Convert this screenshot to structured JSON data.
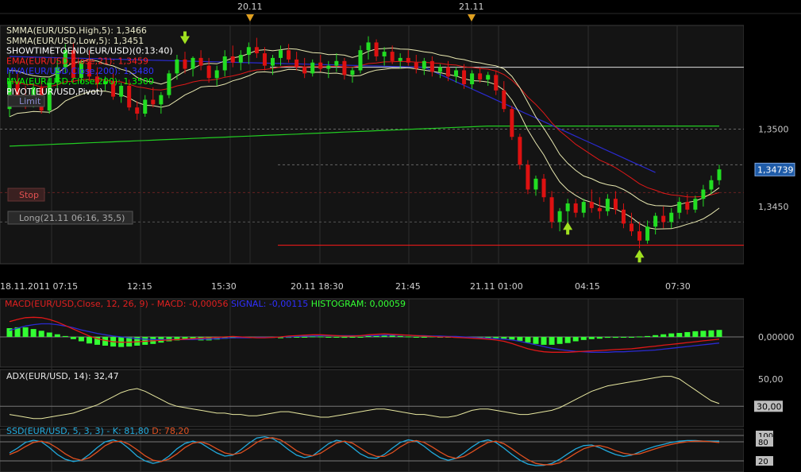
{
  "chart_data": {
    "type": "candlestick",
    "instrument": "EUR/USD",
    "date_markers": [
      "20.11",
      "21.11"
    ],
    "time_axis": [
      "18.11.2011 07:15",
      "12:15",
      "15:30",
      "20.11 18:30",
      "21:45",
      "21.11 01:00",
      "04:15",
      "07:30"
    ],
    "y_ticks": [
      "1,3500",
      "1,3450"
    ],
    "y_tick_values": [
      1.35,
      1.345
    ],
    "y_range": [
      1.3413,
      1.3567
    ],
    "current_price": {
      "label": "1,34739",
      "value": 1.34739
    },
    "legend": [
      {
        "text": "SMMA(EUR/USD,High,5): 1,3466",
        "color": "#e8e8c8"
      },
      {
        "text": "SMMA(EUR/USD,Low,5): 1,3451",
        "color": "#e8e8c8"
      },
      {
        "text": "SHOWTIMETOEND(EUR/USD)(0:13:40)",
        "color": "#ffffff"
      },
      {
        "text": "EMA(EUR/USD,Close,21): 1,3459",
        "color": "#ff2020"
      },
      {
        "text": "MVA(EUR/USD,Close,200): 1,3480",
        "color": "#3030ff"
      },
      {
        "text": "MVA(EUR/USD,Close,200): 1,3500",
        "color": "#00ff00"
      },
      {
        "text": "PIVOT(EUR/USD,Pivot)",
        "color": "#ffffff"
      }
    ],
    "order_tags": {
      "limit": "Limit",
      "stop": "Stop",
      "position": "Long(21.11 06:16, 35,5)"
    },
    "candles": [
      [
        1.3513,
        1.3538,
        1.3508,
        1.3531
      ],
      [
        1.3531,
        1.3536,
        1.3519,
        1.3522
      ],
      [
        1.3522,
        1.3528,
        1.3513,
        1.3516
      ],
      [
        1.3516,
        1.353,
        1.3514,
        1.3527
      ],
      [
        1.3527,
        1.3531,
        1.351,
        1.3512
      ],
      [
        1.3512,
        1.3533,
        1.351,
        1.353
      ],
      [
        1.353,
        1.3546,
        1.3525,
        1.354
      ],
      [
        1.354,
        1.3555,
        1.3536,
        1.3551
      ],
      [
        1.3551,
        1.3556,
        1.353,
        1.3533
      ],
      [
        1.3533,
        1.3545,
        1.353,
        1.3543
      ],
      [
        1.3543,
        1.3551,
        1.3531,
        1.3534
      ],
      [
        1.3534,
        1.354,
        1.3526,
        1.3529
      ],
      [
        1.3529,
        1.3534,
        1.3525,
        1.3531
      ],
      [
        1.3531,
        1.3536,
        1.3519,
        1.3521
      ],
      [
        1.3521,
        1.353,
        1.3517,
        1.3528
      ],
      [
        1.3528,
        1.3532,
        1.3512,
        1.3514
      ],
      [
        1.3514,
        1.3518,
        1.3506,
        1.351
      ],
      [
        1.351,
        1.3522,
        1.3508,
        1.3519
      ],
      [
        1.3519,
        1.3527,
        1.3514,
        1.3516
      ],
      [
        1.3516,
        1.3524,
        1.351,
        1.3522
      ],
      [
        1.3522,
        1.3538,
        1.352,
        1.3536
      ],
      [
        1.3536,
        1.3548,
        1.3532,
        1.3545
      ],
      [
        1.3545,
        1.355,
        1.3536,
        1.3539
      ],
      [
        1.3539,
        1.3547,
        1.3534,
        1.3546
      ],
      [
        1.3546,
        1.3551,
        1.3538,
        1.3541
      ],
      [
        1.3541,
        1.3546,
        1.353,
        1.3533
      ],
      [
        1.3533,
        1.3541,
        1.3528,
        1.3538
      ],
      [
        1.3538,
        1.3551,
        1.3534,
        1.3547
      ],
      [
        1.3547,
        1.3554,
        1.354,
        1.3543
      ],
      [
        1.3543,
        1.3551,
        1.3538,
        1.3548
      ],
      [
        1.3548,
        1.3556,
        1.3542,
        1.3553
      ],
      [
        1.3553,
        1.3559,
        1.3546,
        1.3549
      ],
      [
        1.3549,
        1.3553,
        1.3538,
        1.3541
      ],
      [
        1.3541,
        1.3548,
        1.3535,
        1.3546
      ],
      [
        1.3546,
        1.3554,
        1.3541,
        1.3551
      ],
      [
        1.3551,
        1.3555,
        1.3543,
        1.3545
      ],
      [
        1.3545,
        1.355,
        1.3538,
        1.354
      ],
      [
        1.354,
        1.3546,
        1.3533,
        1.3536
      ],
      [
        1.3536,
        1.3545,
        1.3534,
        1.3543
      ],
      [
        1.3543,
        1.3548,
        1.3537,
        1.3539
      ],
      [
        1.3539,
        1.3544,
        1.3533,
        1.3541
      ],
      [
        1.3541,
        1.3549,
        1.3537,
        1.3544
      ],
      [
        1.3544,
        1.3546,
        1.3532,
        1.3535
      ],
      [
        1.3535,
        1.354,
        1.353,
        1.3538
      ],
      [
        1.3538,
        1.3554,
        1.3536,
        1.3551
      ],
      [
        1.3551,
        1.356,
        1.3545,
        1.3556
      ],
      [
        1.3556,
        1.3558,
        1.3544,
        1.3547
      ],
      [
        1.3547,
        1.3553,
        1.3541,
        1.355
      ],
      [
        1.355,
        1.3554,
        1.3542,
        1.3544
      ],
      [
        1.3544,
        1.3549,
        1.3539,
        1.3546
      ],
      [
        1.3546,
        1.3551,
        1.3541,
        1.3543
      ],
      [
        1.3543,
        1.3548,
        1.3536,
        1.3539
      ],
      [
        1.3539,
        1.3546,
        1.3535,
        1.3544
      ],
      [
        1.3544,
        1.3547,
        1.3534,
        1.3537
      ],
      [
        1.3537,
        1.3542,
        1.3533,
        1.354
      ],
      [
        1.354,
        1.3544,
        1.3531,
        1.3534
      ],
      [
        1.3534,
        1.354,
        1.353,
        1.3538
      ],
      [
        1.3538,
        1.3542,
        1.3526,
        1.3529
      ],
      [
        1.3529,
        1.3538,
        1.3526,
        1.3536
      ],
      [
        1.3536,
        1.354,
        1.353,
        1.3532
      ],
      [
        1.3532,
        1.3537,
        1.3528,
        1.3535
      ],
      [
        1.3535,
        1.3538,
        1.3522,
        1.3525
      ],
      [
        1.3525,
        1.3531,
        1.3511,
        1.3513
      ],
      [
        1.3513,
        1.3515,
        1.3493,
        1.3495
      ],
      [
        1.3495,
        1.3497,
        1.3474,
        1.3477
      ],
      [
        1.3477,
        1.348,
        1.3458,
        1.3461
      ],
      [
        1.3461,
        1.347,
        1.3457,
        1.3468
      ],
      [
        1.3468,
        1.3471,
        1.3453,
        1.3456
      ],
      [
        1.3456,
        1.346,
        1.3436,
        1.344
      ],
      [
        1.344,
        1.3449,
        1.3434,
        1.3447
      ],
      [
        1.3447,
        1.3455,
        1.344,
        1.3452
      ],
      [
        1.3452,
        1.3455,
        1.3443,
        1.3446
      ],
      [
        1.3446,
        1.3455,
        1.3443,
        1.3453
      ],
      [
        1.3453,
        1.3461,
        1.3446,
        1.3449
      ],
      [
        1.3449,
        1.3456,
        1.3442,
        1.3447
      ],
      [
        1.3447,
        1.3458,
        1.3444,
        1.3455
      ],
      [
        1.3455,
        1.346,
        1.3445,
        1.3448
      ],
      [
        1.3448,
        1.3452,
        1.3436,
        1.3439
      ],
      [
        1.3439,
        1.3446,
        1.3431,
        1.3434
      ],
      [
        1.3434,
        1.344,
        1.3423,
        1.3428
      ],
      [
        1.3428,
        1.3441,
        1.3426,
        1.3437
      ],
      [
        1.3437,
        1.3446,
        1.3432,
        1.3444
      ],
      [
        1.3444,
        1.345,
        1.3436,
        1.344
      ],
      [
        1.344,
        1.3449,
        1.3436,
        1.3446
      ],
      [
        1.3446,
        1.3456,
        1.3442,
        1.3453
      ],
      [
        1.3453,
        1.3458,
        1.3445,
        1.3448
      ],
      [
        1.3448,
        1.3457,
        1.3446,
        1.3455
      ],
      [
        1.3455,
        1.3464,
        1.345,
        1.3461
      ],
      [
        1.3461,
        1.347,
        1.3458,
        1.3467
      ],
      [
        1.3467,
        1.3477,
        1.3464,
        1.3474
      ]
    ],
    "lines": {
      "pivot": 1.354,
      "stop_level": 1.3459,
      "position_level": 1.344,
      "dashed_1": 1.35,
      "dashed_2": 1.3477,
      "red_level": 1.3425
    },
    "markers": {
      "down_arrow": {
        "candle": 22,
        "price": 1.3558
      },
      "up_arrows": [
        {
          "candle": 70,
          "price": 1.3436
        },
        {
          "candle": 79,
          "price": 1.3418
        }
      ]
    },
    "macd": {
      "label_main": "MACD(EUR/USD,Close, 12, 26, 9) -  MACD: -0,00056",
      "label_signal": "SIGNAL: -0,00115",
      "label_hist": "HISTOGRAM: 0,00059",
      "tick": "0,00000",
      "histogram": [
        0.2,
        0.22,
        0.22,
        0.18,
        0.14,
        0.1,
        0.06,
        0.02,
        -0.05,
        -0.1,
        -0.15,
        -0.18,
        -0.2,
        -0.22,
        -0.23,
        -0.22,
        -0.2,
        -0.18,
        -0.16,
        -0.13,
        -0.1,
        -0.08,
        -0.06,
        -0.06,
        -0.08,
        -0.08,
        -0.06,
        -0.04,
        -0.03,
        -0.02,
        -0.02,
        -0.01,
        -0.02,
        -0.02,
        -0.03,
        -0.02,
        -0.01,
        0.0,
        0.01,
        0.01,
        0.0,
        -0.01,
        -0.02,
        -0.01,
        0.0,
        0.02,
        0.03,
        0.04,
        0.03,
        0.02,
        0.01,
        0.0,
        0.0,
        0.01,
        0.0,
        -0.01,
        -0.02,
        -0.02,
        -0.03,
        -0.03,
        -0.03,
        -0.03,
        -0.04,
        -0.06,
        -0.09,
        -0.13,
        -0.16,
        -0.18,
        -0.18,
        -0.16,
        -0.14,
        -0.1,
        -0.07,
        -0.05,
        -0.04,
        -0.02,
        -0.02,
        -0.01,
        0.0,
        0.01,
        0.02,
        0.04,
        0.06,
        0.08,
        0.09,
        0.11,
        0.13,
        0.14,
        0.15,
        0.16
      ],
      "macd_line": [
        0.35,
        0.4,
        0.44,
        0.45,
        0.44,
        0.4,
        0.34,
        0.26,
        0.18,
        0.1,
        0.02,
        -0.04,
        -0.08,
        -0.11,
        -0.12,
        -0.12,
        -0.11,
        -0.1,
        -0.09,
        -0.08,
        -0.07,
        -0.06,
        -0.05,
        -0.04,
        -0.03,
        -0.02,
        -0.01,
        0.0,
        0.01,
        0.0,
        -0.01,
        -0.02,
        -0.02,
        -0.01,
        0.0,
        0.02,
        0.03,
        0.04,
        0.05,
        0.05,
        0.04,
        0.03,
        0.02,
        0.02,
        0.03,
        0.05,
        0.06,
        0.07,
        0.06,
        0.05,
        0.04,
        0.03,
        0.02,
        0.01,
        0.0,
        0.0,
        -0.01,
        -0.02,
        -0.03,
        -0.04,
        -0.05,
        -0.07,
        -0.1,
        -0.15,
        -0.21,
        -0.27,
        -0.31,
        -0.34,
        -0.35,
        -0.35,
        -0.35,
        -0.34,
        -0.33,
        -0.32,
        -0.31,
        -0.3,
        -0.29,
        -0.28,
        -0.27,
        -0.25,
        -0.23,
        -0.21,
        -0.19,
        -0.17,
        -0.15,
        -0.13,
        -0.11,
        -0.09,
        -0.07,
        -0.05
      ],
      "signal_line": [
        0.15,
        0.2,
        0.25,
        0.28,
        0.3,
        0.3,
        0.28,
        0.25,
        0.21,
        0.16,
        0.12,
        0.08,
        0.05,
        0.02,
        0.0,
        -0.02,
        -0.04,
        -0.05,
        -0.06,
        -0.06,
        -0.06,
        -0.06,
        -0.06,
        -0.06,
        -0.05,
        -0.05,
        -0.04,
        -0.03,
        -0.02,
        -0.02,
        -0.02,
        -0.01,
        -0.01,
        -0.01,
        0.0,
        0.0,
        0.01,
        0.02,
        0.02,
        0.03,
        0.03,
        0.03,
        0.03,
        0.03,
        0.03,
        0.03,
        0.03,
        0.04,
        0.04,
        0.04,
        0.04,
        0.03,
        0.03,
        0.02,
        0.02,
        0.01,
        0.01,
        0.0,
        -0.01,
        -0.02,
        -0.03,
        -0.04,
        -0.05,
        -0.07,
        -0.1,
        -0.14,
        -0.18,
        -0.22,
        -0.26,
        -0.29,
        -0.31,
        -0.33,
        -0.34,
        -0.35,
        -0.35,
        -0.35,
        -0.34,
        -0.34,
        -0.33,
        -0.32,
        -0.31,
        -0.3,
        -0.28,
        -0.26,
        -0.24,
        -0.22,
        -0.2,
        -0.18,
        -0.16,
        -0.14
      ]
    },
    "adx": {
      "label": "ADX(EUR/USD, 14): 32,47",
      "ticks": [
        "50,00",
        "30,00"
      ],
      "tick_values": [
        50,
        30
      ],
      "range": [
        15,
        57
      ],
      "values": [
        24,
        23,
        22,
        21,
        21,
        22,
        23,
        24,
        25,
        27,
        29,
        31,
        34,
        37,
        40,
        42,
        43,
        41,
        38,
        35,
        32,
        30,
        29,
        28,
        27,
        26,
        25,
        25,
        24,
        24,
        23,
        23,
        24,
        25,
        26,
        26,
        25,
        24,
        23,
        22,
        22,
        23,
        24,
        25,
        26,
        27,
        28,
        28,
        27,
        26,
        25,
        24,
        24,
        23,
        22,
        22,
        23,
        25,
        27,
        28,
        28,
        27,
        26,
        25,
        24,
        24,
        25,
        26,
        27,
        29,
        32,
        35,
        38,
        41,
        43,
        45,
        46,
        47,
        48,
        49,
        50,
        51,
        52,
        52,
        50,
        46,
        42,
        38,
        34,
        32
      ]
    },
    "stochastic": {
      "label": "SSD(EUR/USD, 5, 3, 3) -  K: 81,80",
      "label_d": "D: 78,20",
      "ticks": [
        "100",
        "80",
        "20"
      ],
      "tick_values": [
        100,
        80,
        20
      ],
      "k": [
        45,
        60,
        78,
        85,
        80,
        62,
        40,
        25,
        18,
        22,
        40,
        62,
        80,
        86,
        78,
        58,
        35,
        20,
        12,
        18,
        35,
        58,
        75,
        82,
        76,
        60,
        45,
        35,
        38,
        55,
        75,
        92,
        96,
        90,
        75,
        55,
        38,
        30,
        36,
        55,
        74,
        85,
        80,
        62,
        42,
        30,
        28,
        40,
        60,
        78,
        86,
        82,
        66,
        46,
        30,
        22,
        28,
        45,
        64,
        80,
        86,
        78,
        60,
        40,
        22,
        10,
        5,
        6,
        12,
        25,
        42,
        58,
        68,
        70,
        62,
        50,
        40,
        34,
        38,
        48,
        58,
        66,
        72,
        78,
        82,
        84,
        84,
        82,
        82,
        82
      ],
      "d": [
        40,
        50,
        65,
        78,
        82,
        75,
        60,
        42,
        28,
        22,
        30,
        48,
        68,
        80,
        82,
        72,
        55,
        36,
        22,
        18,
        26,
        42,
        62,
        76,
        80,
        72,
        58,
        45,
        40,
        45,
        60,
        78,
        90,
        93,
        86,
        70,
        52,
        40,
        36,
        44,
        60,
        76,
        82,
        76,
        60,
        44,
        34,
        34,
        46,
        64,
        78,
        84,
        78,
        64,
        48,
        34,
        28,
        34,
        48,
        64,
        78,
        82,
        74,
        58,
        40,
        24,
        12,
        8,
        8,
        14,
        28,
        44,
        58,
        66,
        68,
        62,
        52,
        44,
        40,
        42,
        50,
        58,
        66,
        72,
        77,
        80,
        82,
        82,
        80,
        78
      ]
    }
  }
}
